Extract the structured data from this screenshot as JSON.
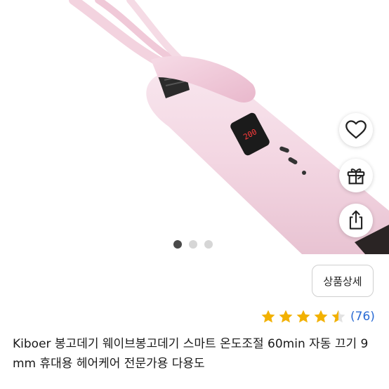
{
  "product_image": {
    "display_temperature": "200",
    "brand_color": "#f4dde6"
  },
  "actions": {
    "like_icon": "heart-outline-icon",
    "gift_icon": "gift-icon",
    "share_icon": "share-icon"
  },
  "carousel": {
    "total": 3,
    "current": 1
  },
  "detail_button": {
    "label": "상품상세"
  },
  "rating": {
    "stars": 4.5,
    "count_text": "(76)",
    "star_color": "#f2b100"
  },
  "product": {
    "title": "Kiboer 봉고데기 웨이브봉고데기 스마트 온도조절 60min 자동 끄기 9mm 휴대용 헤어케어 전문가용 다용도"
  }
}
